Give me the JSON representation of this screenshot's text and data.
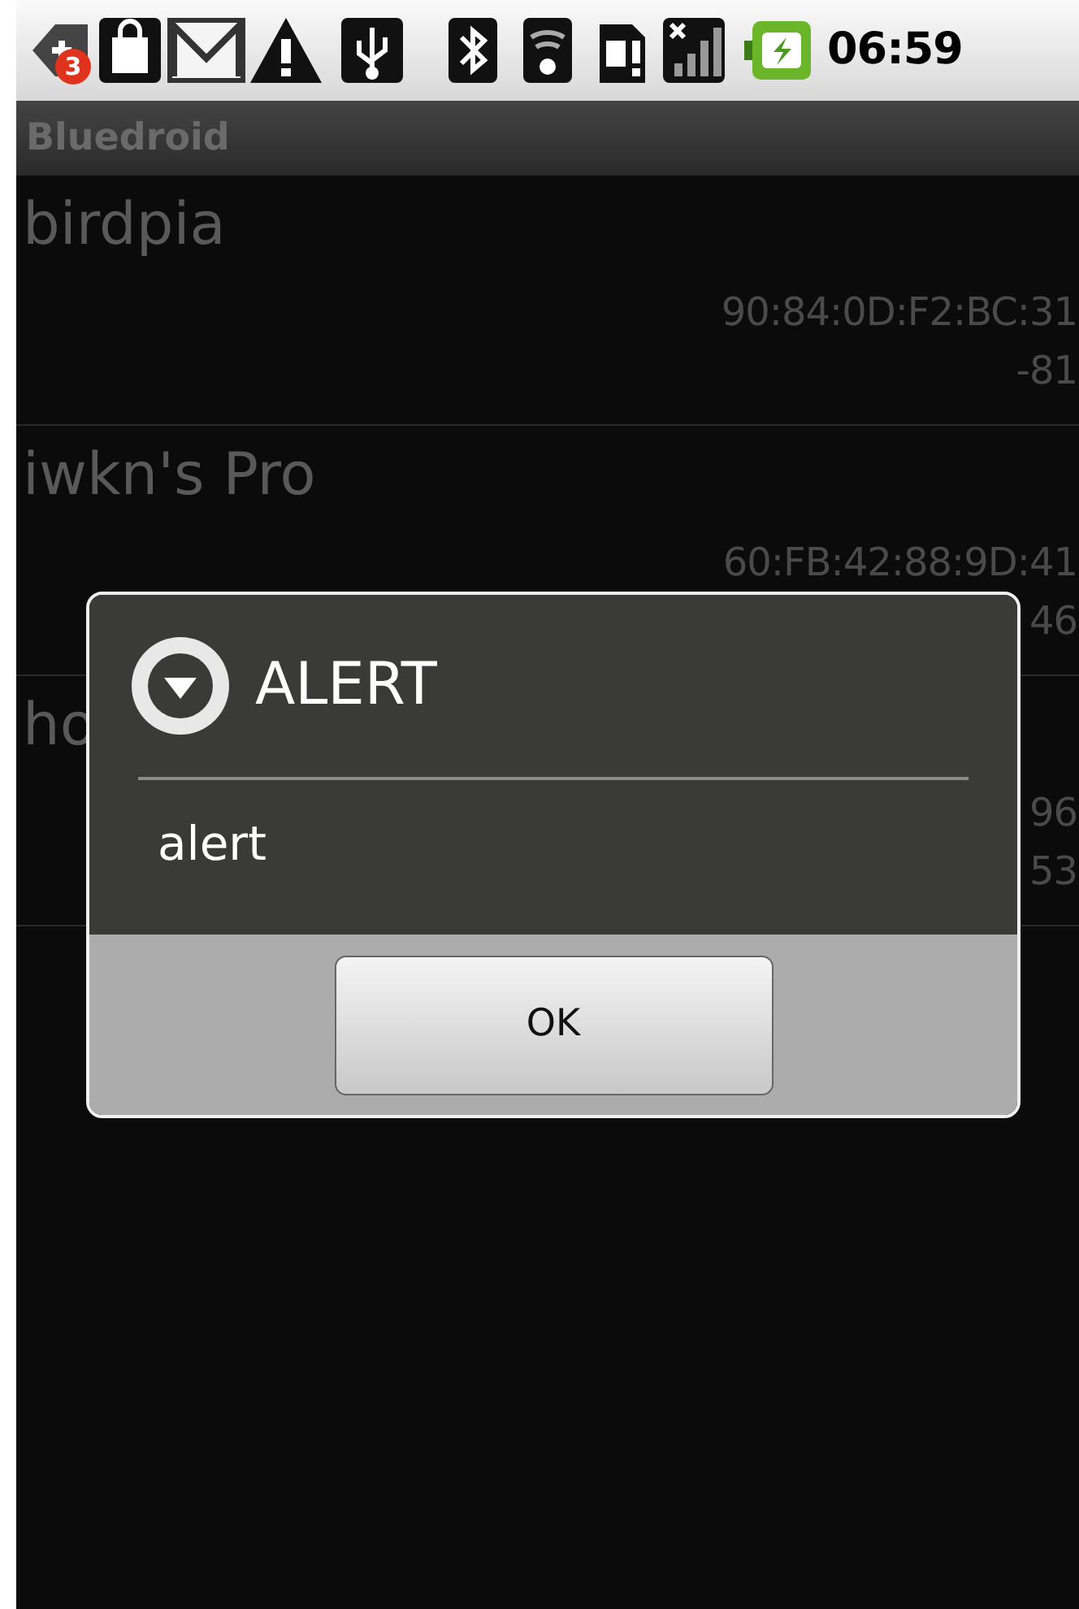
{
  "status_bar": {
    "notification_badge": "3",
    "time": "06:59"
  },
  "app_bar": {
    "title": "Bluedroid"
  },
  "devices": [
    {
      "name": "birdpia",
      "address": "90:84:0D:F2:BC:31",
      "rssi": "-81"
    },
    {
      "name": "iwkn's Pro",
      "address": "60:FB:42:88:9D:41",
      "rssi": "46"
    },
    {
      "name": "ho",
      "address": "96",
      "rssi": "53"
    }
  ],
  "dialog": {
    "title": "ALERT",
    "message": "alert",
    "buttons": [
      "OK"
    ]
  }
}
